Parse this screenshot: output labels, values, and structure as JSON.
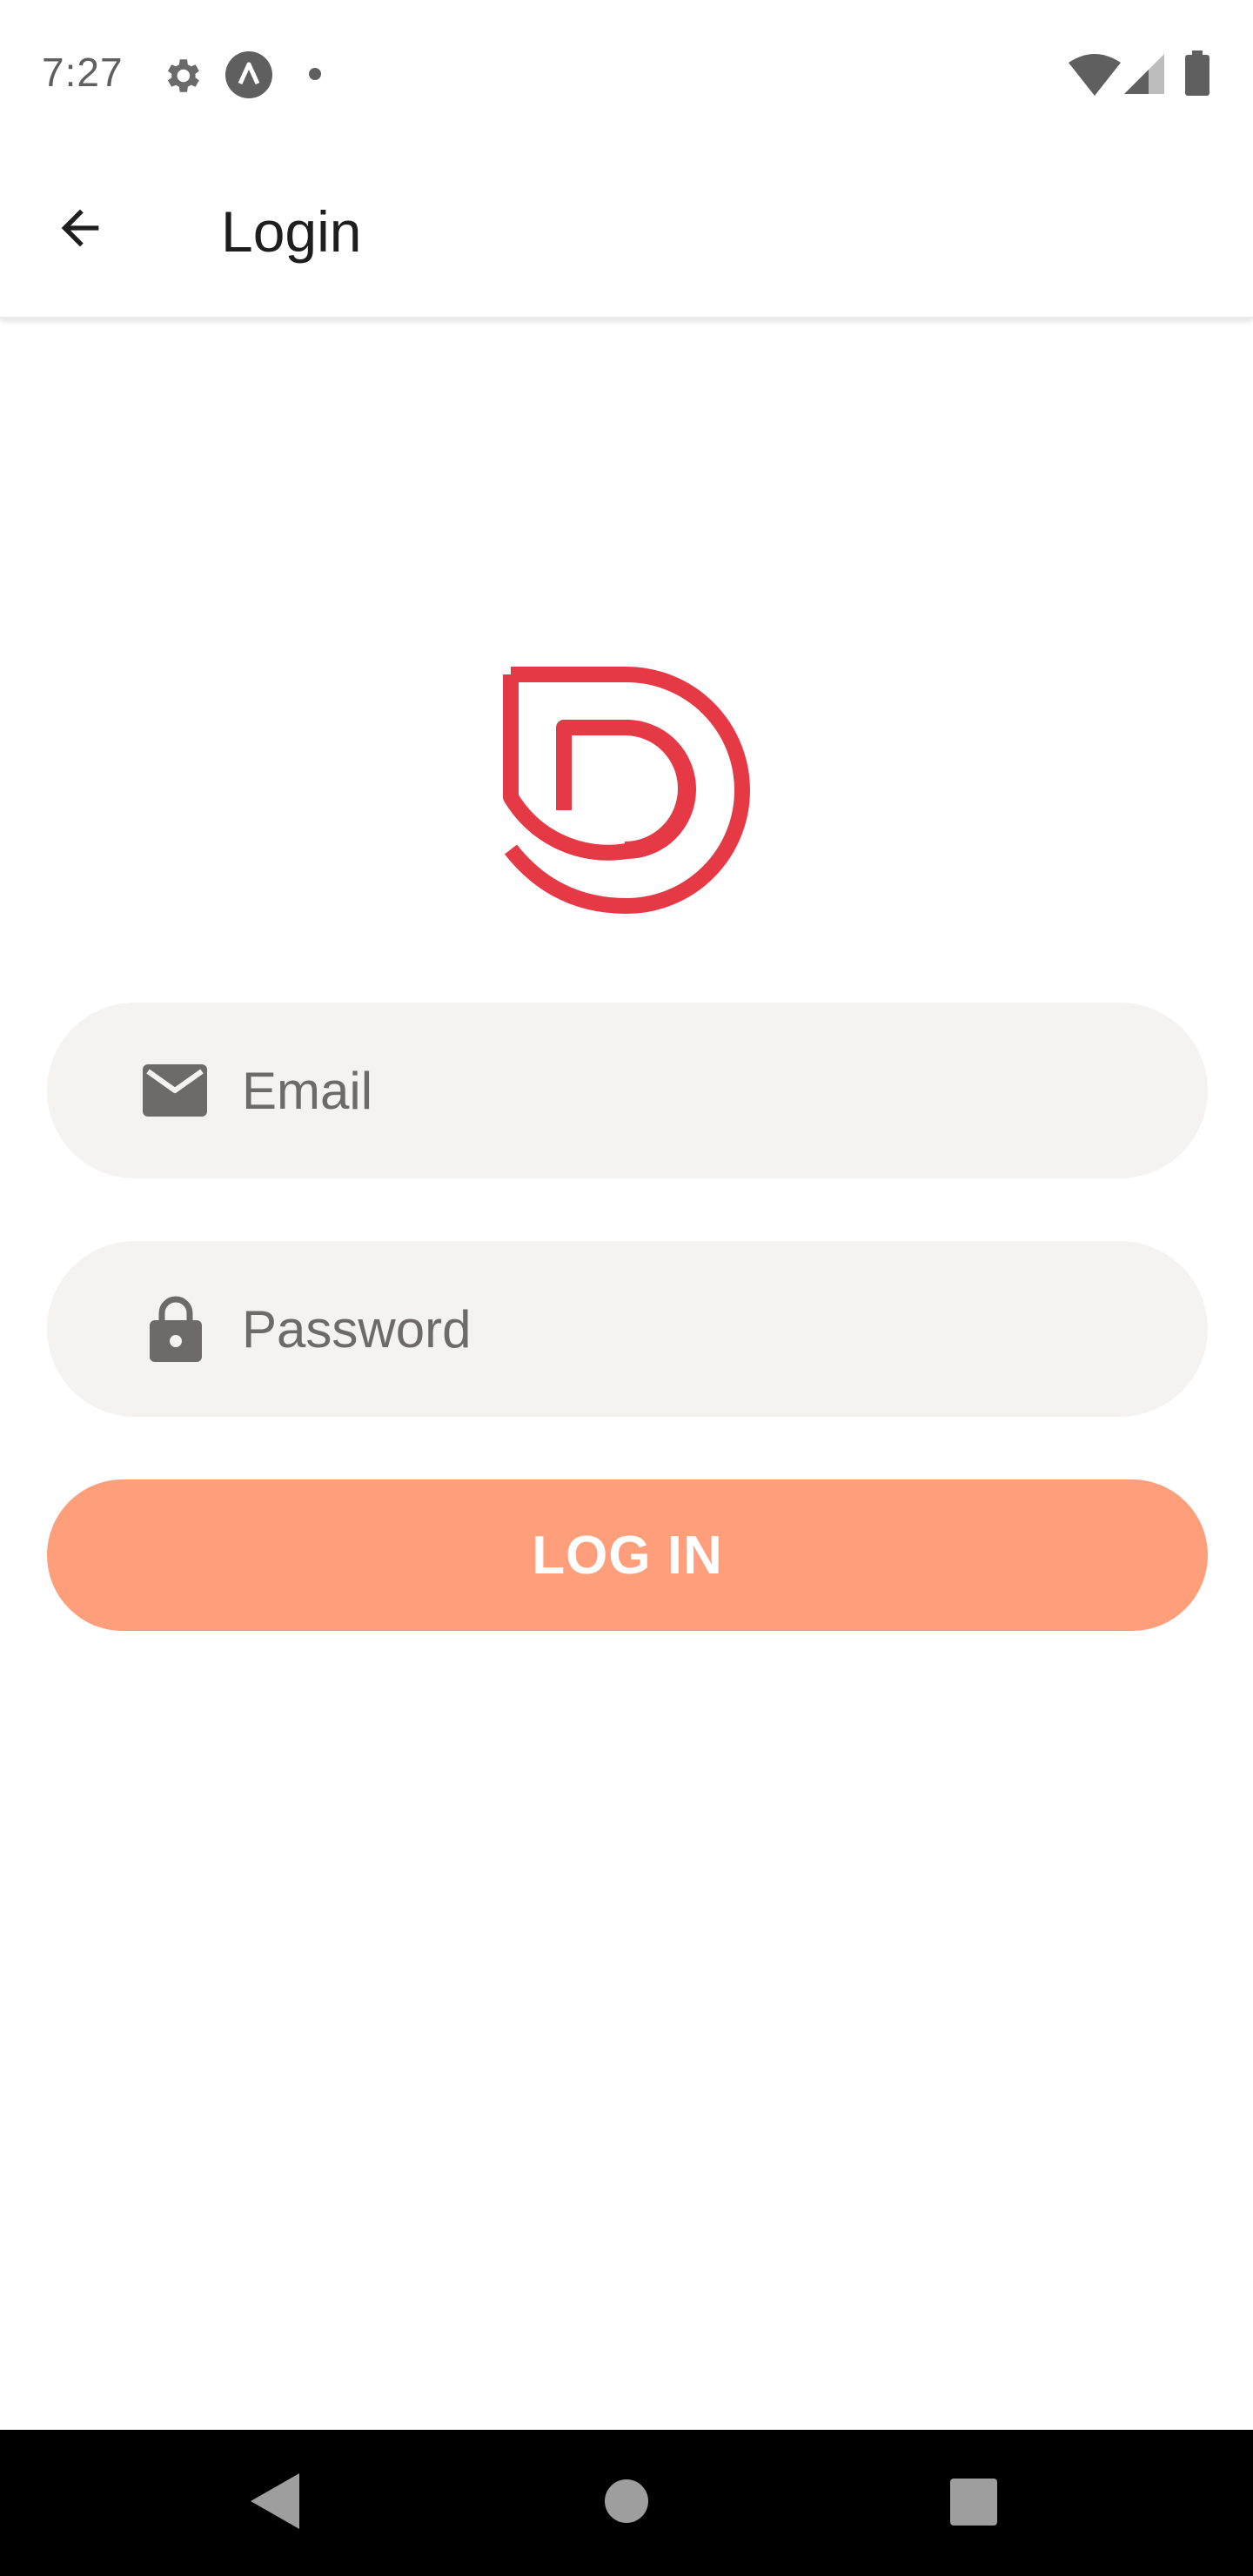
{
  "status_bar": {
    "time": "7:27",
    "icons": [
      "settings-icon",
      "app-notification-icon",
      "dot-icon",
      "wifi-icon",
      "signal-icon",
      "battery-icon"
    ]
  },
  "app_bar": {
    "title": "Login",
    "back_icon": "arrow-back-icon"
  },
  "logo": {
    "icon": "brand-logo",
    "color": "#e63946"
  },
  "form": {
    "email": {
      "placeholder": "Email",
      "value": "",
      "icon": "email-icon"
    },
    "password": {
      "placeholder": "Password",
      "value": "",
      "icon": "lock-icon"
    },
    "submit_label": "LOG IN"
  },
  "colors": {
    "accent": "#ff9e7a",
    "logo": "#e63946",
    "input_bg": "#f5f2f2",
    "icon_gray": "#6f6a6a"
  },
  "nav_bar": {
    "buttons": [
      "back-nav-icon",
      "home-nav-icon",
      "recents-nav-icon"
    ]
  }
}
